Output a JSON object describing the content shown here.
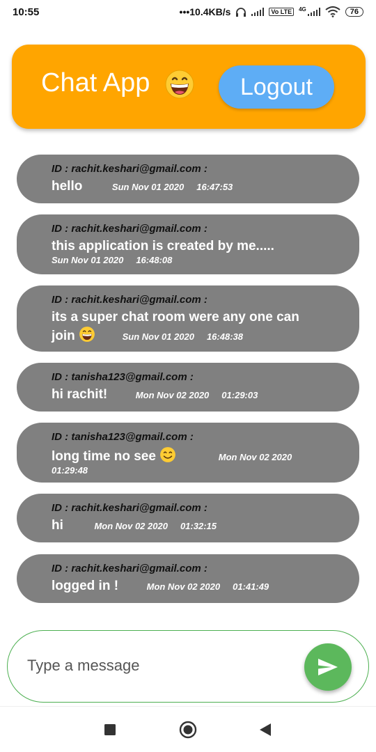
{
  "status_bar": {
    "time": "10:55",
    "net_speed": "•••10.4KB/s",
    "volte_label": "Vo LTE",
    "lte_label": "4G",
    "battery": "76"
  },
  "header": {
    "title": "Chat App",
    "title_emoji": "grinning-face-icon",
    "logout_label": "Logout",
    "bg_color": "#FFA500",
    "logout_color": "#5EADF5"
  },
  "messages": [
    {
      "id_line": "ID : rachit.keshari@gmail.com :",
      "text": "hello",
      "date": "Sun Nov 01 2020",
      "time": "16:47:53"
    },
    {
      "id_line": "ID : rachit.keshari@gmail.com :",
      "text": "this application is created by me.....",
      "date": "Sun Nov 01 2020",
      "time": "16:48:08"
    },
    {
      "id_line": "ID : rachit.keshari@gmail.com :",
      "text": "its a super chat room were any one can join",
      "date": "Sun Nov 01 2020",
      "time": "16:48:38"
    },
    {
      "id_line": "ID : tanisha123@gmail.com :",
      "text": "hi rachit!",
      "date": "Mon Nov 02 2020",
      "time": "01:29:03"
    },
    {
      "id_line": "ID : tanisha123@gmail.com :",
      "text": "long time no see",
      "date": "Mon Nov 02 2020",
      "time": "01:29:48"
    },
    {
      "id_line": "ID : rachit.keshari@gmail.com :",
      "text": "hi",
      "date": "Mon Nov 02 2020",
      "time": "01:32:15"
    },
    {
      "id_line": "ID : rachit.keshari@gmail.com :",
      "text": "logged in !",
      "date": "Mon Nov 02 2020",
      "time": "01:41:49"
    }
  ],
  "composer": {
    "placeholder": "Type a message",
    "send_icon": "send-icon",
    "border_color": "#4CAF50",
    "send_color": "#5CB85C"
  },
  "message_bubble_color": "#808080",
  "nav_bar": {
    "icons": [
      "recents-icon",
      "home-icon",
      "back-icon"
    ]
  }
}
